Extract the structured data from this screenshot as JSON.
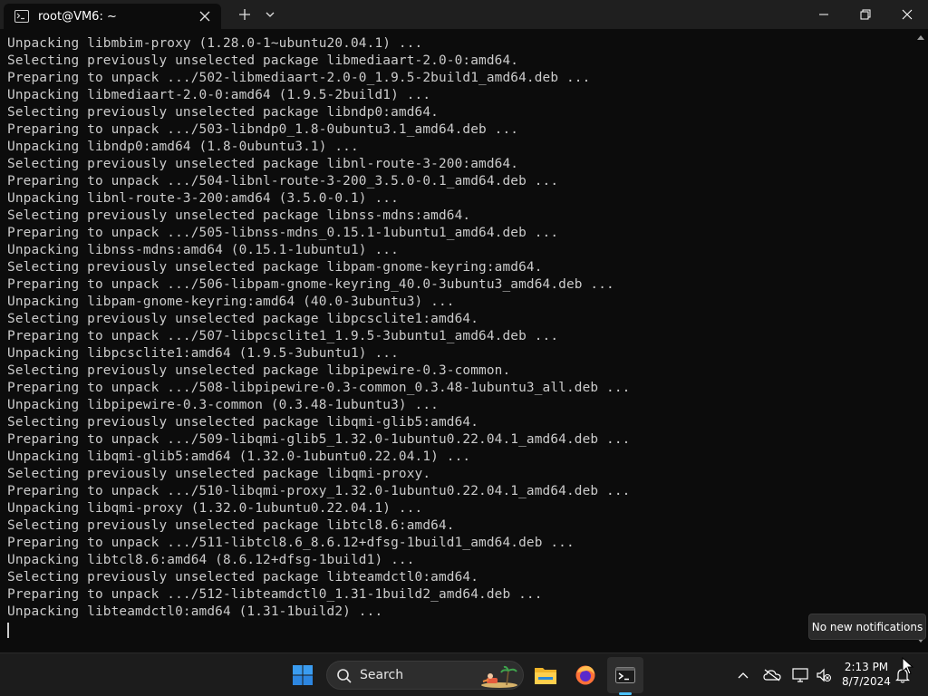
{
  "window": {
    "tab_title": "root@VM6: ~",
    "tab_icon": "terminal-icon"
  },
  "terminal": {
    "lines": [
      "Unpacking libmbim-proxy (1.28.0-1~ubuntu20.04.1) ...",
      "Selecting previously unselected package libmediaart-2.0-0:amd64.",
      "Preparing to unpack .../502-libmediaart-2.0-0_1.9.5-2build1_amd64.deb ...",
      "Unpacking libmediaart-2.0-0:amd64 (1.9.5-2build1) ...",
      "Selecting previously unselected package libndp0:amd64.",
      "Preparing to unpack .../503-libndp0_1.8-0ubuntu3.1_amd64.deb ...",
      "Unpacking libndp0:amd64 (1.8-0ubuntu3.1) ...",
      "Selecting previously unselected package libnl-route-3-200:amd64.",
      "Preparing to unpack .../504-libnl-route-3-200_3.5.0-0.1_amd64.deb ...",
      "Unpacking libnl-route-3-200:amd64 (3.5.0-0.1) ...",
      "Selecting previously unselected package libnss-mdns:amd64.",
      "Preparing to unpack .../505-libnss-mdns_0.15.1-1ubuntu1_amd64.deb ...",
      "Unpacking libnss-mdns:amd64 (0.15.1-1ubuntu1) ...",
      "Selecting previously unselected package libpam-gnome-keyring:amd64.",
      "Preparing to unpack .../506-libpam-gnome-keyring_40.0-3ubuntu3_amd64.deb ...",
      "Unpacking libpam-gnome-keyring:amd64 (40.0-3ubuntu3) ...",
      "Selecting previously unselected package libpcsclite1:amd64.",
      "Preparing to unpack .../507-libpcsclite1_1.9.5-3ubuntu1_amd64.deb ...",
      "Unpacking libpcsclite1:amd64 (1.9.5-3ubuntu1) ...",
      "Selecting previously unselected package libpipewire-0.3-common.",
      "Preparing to unpack .../508-libpipewire-0.3-common_0.3.48-1ubuntu3_all.deb ...",
      "Unpacking libpipewire-0.3-common (0.3.48-1ubuntu3) ...",
      "Selecting previously unselected package libqmi-glib5:amd64.",
      "Preparing to unpack .../509-libqmi-glib5_1.32.0-1ubuntu0.22.04.1_amd64.deb ...",
      "Unpacking libqmi-glib5:amd64 (1.32.0-1ubuntu0.22.04.1) ...",
      "Selecting previously unselected package libqmi-proxy.",
      "Preparing to unpack .../510-libqmi-proxy_1.32.0-1ubuntu0.22.04.1_amd64.deb ...",
      "Unpacking libqmi-proxy (1.32.0-1ubuntu0.22.04.1) ...",
      "Selecting previously unselected package libtcl8.6:amd64.",
      "Preparing to unpack .../511-libtcl8.6_8.6.12+dfsg-1build1_amd64.deb ...",
      "Unpacking libtcl8.6:amd64 (8.6.12+dfsg-1build1) ...",
      "Selecting previously unselected package libteamdctl0:amd64.",
      "Preparing to unpack .../512-libteamdctl0_1.31-1build2_amd64.deb ...",
      "Unpacking libteamdctl0:amd64 (1.31-1build2) ..."
    ]
  },
  "tooltip": {
    "text": "No new notifications"
  },
  "taskbar": {
    "search_label": "Search",
    "apps": [
      "start-icon",
      "file-explorer-icon",
      "firefox-icon",
      "terminal-icon"
    ],
    "active_app": "terminal-icon",
    "accent": "#4cc2ff"
  },
  "clock": {
    "time": "2:13 PM",
    "date": "8/7/2024"
  },
  "colors": {
    "terminal_bg": "#0c0c0c",
    "terminal_fg": "#cccccc",
    "titlebar_bg": "#1f1f1f",
    "taskbar_bg": "#1c1c1c"
  }
}
